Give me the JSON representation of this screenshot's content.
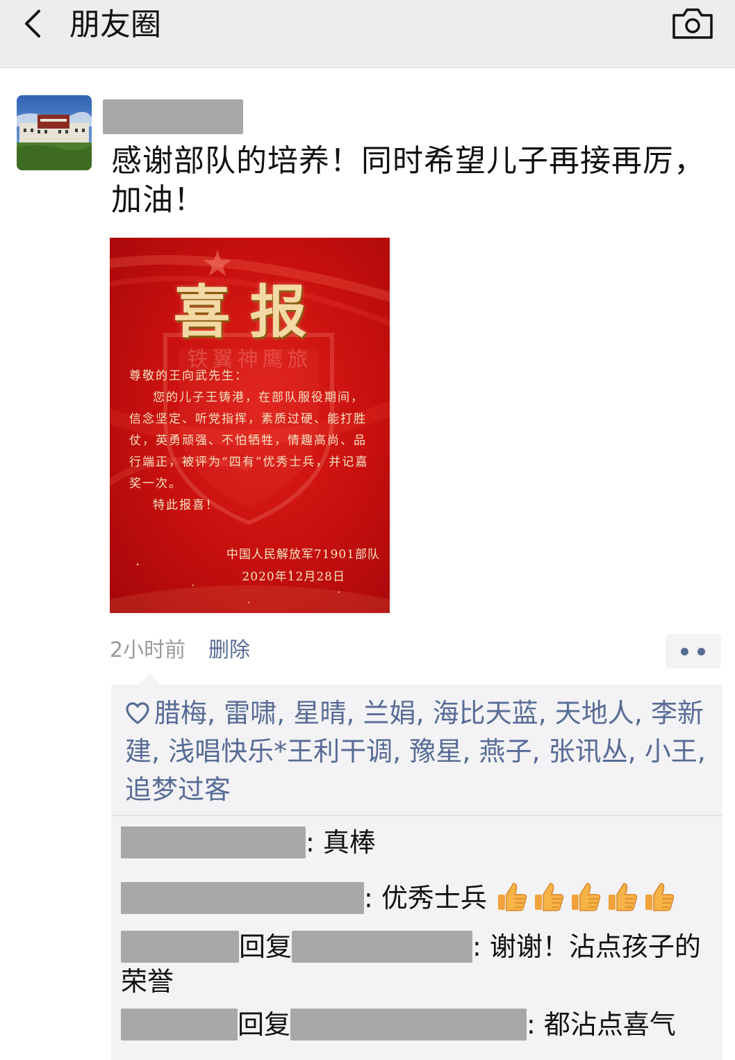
{
  "nav": {
    "title": "朋友圈",
    "back_icon": "chevron-left-icon",
    "camera_icon": "camera-icon"
  },
  "post": {
    "text": "感谢部队的培养！同时希望儿子再接再厉，加油！",
    "image": {
      "title": "喜报",
      "faint_text": "铁翼神鹰旅",
      "greeting": "尊敬的王向武先生：",
      "body": "您的儿子王铸港，在部队服役期间，信念坚定、听党指挥，素质过硬、能打胜仗，英勇顽强、不怕牺牲，情趣高尚、品行端正，被评为“四有”优秀士兵，并记嘉奖一次。",
      "closing": "特此报喜！",
      "unit": "中国人民解放军71901部队",
      "date": "2020年12月28日"
    },
    "time": "2小时前",
    "delete_label": "删除",
    "more_icon": "more-dots-icon"
  },
  "likes": {
    "icon": "heart-icon",
    "names": "腊梅, 雷啸, 星晴, 兰娟, 海比天蓝, 天地人, 李新建, 浅唱快乐*王利干调, 豫星, 燕子, 张讯丛, 小王, 追梦过客"
  },
  "comments": [
    {
      "text": ": 真棒"
    },
    {
      "text": ": 优秀士兵",
      "emoji": "thumbs-up-icon",
      "emoji_count": 5
    },
    {
      "reply_word": "回复",
      "text": ": 谢谢！沾点孩子的荣誉"
    },
    {
      "reply_word": "回复",
      "text": ": 都沾点喜气"
    }
  ],
  "colors": {
    "nav_bg": "#ededed",
    "link_blue": "#576b95",
    "meta_gray": "#9a9a9a",
    "comment_bg": "#f3f3f5",
    "poster_red": "#c8100e",
    "poster_gold": "#f3d9a4"
  }
}
